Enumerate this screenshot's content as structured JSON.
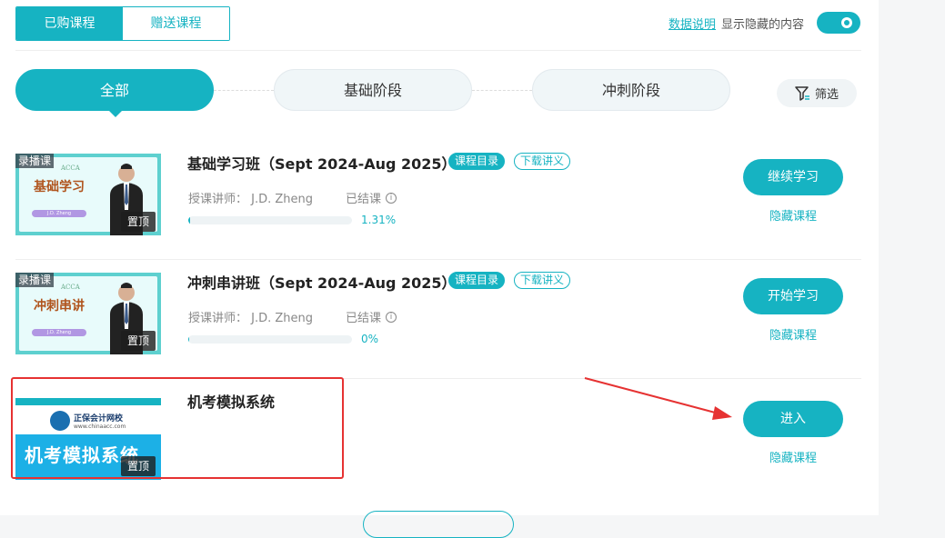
{
  "tabs": [
    {
      "label": "已购课程",
      "active": true
    },
    {
      "label": "赠送课程",
      "active": false
    }
  ],
  "top_right": {
    "data_link": "数据说明",
    "show_hidden_label": "显示隐藏的内容",
    "toggle_on": true
  },
  "stages": [
    {
      "label": "全部",
      "active": true
    },
    {
      "label": "基础阶段",
      "active": false
    },
    {
      "label": "冲刺阶段",
      "active": false
    }
  ],
  "filter_label": "筛选",
  "courses": [
    {
      "title": "基础学习班（Sept 2024-Aug 2025）",
      "badges": [
        "课程目录",
        "下载讲义"
      ],
      "teacher": "授课讲师：  J.D. Zheng",
      "status": "已结课",
      "progress_pct": 1.31,
      "progress_text": "1.31%",
      "button": "继续学习",
      "hide": "隐藏课程",
      "tag_record": "录播课",
      "tag_top": "置顶",
      "thumb_brand": "ACCA",
      "thumb_title": "基础学习",
      "thumb_name": "J.D. Zheng"
    },
    {
      "title": "冲刺串讲班（Sept 2024-Aug 2025）",
      "badges": [
        "课程目录",
        "下载讲义"
      ],
      "teacher": "授课讲师：  J.D. Zheng",
      "status": "已结课",
      "progress_pct": 0,
      "progress_text": "0%",
      "button": "开始学习",
      "hide": "隐藏课程",
      "tag_record": "录播课",
      "tag_top": "置顶",
      "thumb_brand": "ACCA",
      "thumb_title": "冲刺串讲",
      "thumb_name": "J.D. Zheng"
    },
    {
      "title": "机考模拟系统",
      "button": "进入",
      "hide": "隐藏课程",
      "tag_top": "置顶",
      "thumb_school": "正保会计网校",
      "thumb_url": "www.chinaacc.com",
      "thumb_big": "机考模拟系统"
    }
  ],
  "colors": {
    "accent": "#16b3c2",
    "annotation": "#e63232"
  }
}
